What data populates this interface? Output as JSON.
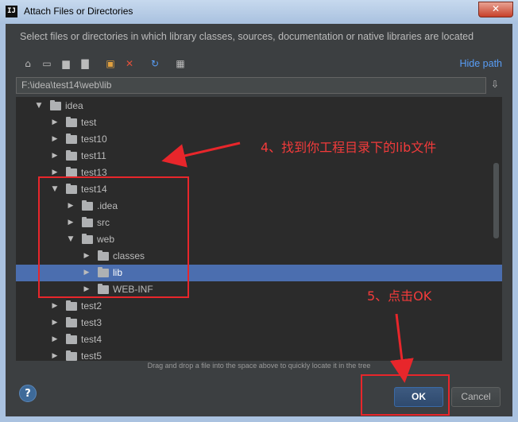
{
  "window": {
    "title": "Attach Files or Directories",
    "app_icon": "IJ",
    "close_icon": "✕"
  },
  "description": "Select files or directories in which library classes, sources, documentation or native libraries are located",
  "toolbar": {
    "icons": [
      "home-icon",
      "desktop-icon",
      "project-icon",
      "module-icon",
      "new-folder-icon",
      "delete-icon",
      "refresh-icon",
      "show-hidden-icon"
    ],
    "hide_path_label": "Hide path"
  },
  "path": {
    "value": "F:\\idea\\test14\\web\\lib"
  },
  "tree": {
    "rows": [
      {
        "label": "idea",
        "expanded": true,
        "depth": 0,
        "selected": false
      },
      {
        "label": "test",
        "expanded": false,
        "depth": 1,
        "selected": false
      },
      {
        "label": "test10",
        "expanded": false,
        "depth": 1,
        "selected": false
      },
      {
        "label": "test11",
        "expanded": false,
        "depth": 1,
        "selected": false
      },
      {
        "label": "test13",
        "expanded": false,
        "depth": 1,
        "selected": false
      },
      {
        "label": "test14",
        "expanded": true,
        "depth": 1,
        "selected": false
      },
      {
        "label": ".idea",
        "expanded": false,
        "depth": 2,
        "selected": false
      },
      {
        "label": "src",
        "expanded": false,
        "depth": 2,
        "selected": false
      },
      {
        "label": "web",
        "expanded": true,
        "depth": 2,
        "selected": false
      },
      {
        "label": "classes",
        "expanded": false,
        "depth": 3,
        "selected": false
      },
      {
        "label": "lib",
        "expanded": false,
        "depth": 3,
        "selected": true
      },
      {
        "label": "WEB-INF",
        "expanded": false,
        "depth": 3,
        "selected": false
      },
      {
        "label": "test2",
        "expanded": false,
        "depth": 1,
        "selected": false
      },
      {
        "label": "test3",
        "expanded": false,
        "depth": 1,
        "selected": false
      },
      {
        "label": "test4",
        "expanded": false,
        "depth": 1,
        "selected": false
      },
      {
        "label": "test5",
        "expanded": false,
        "depth": 1,
        "selected": false
      }
    ]
  },
  "hint": "Drag and drop a file into the space above to quickly locate it in the tree",
  "buttons": {
    "help": "?",
    "ok": "OK",
    "cancel": "Cancel"
  },
  "annotations": {
    "step4": "4、找到你工程目录下的lib文件",
    "step5": "5、点击OK",
    "color": "#e8262b"
  },
  "colors": {
    "selection": "#4b6eaf",
    "link": "#589df6",
    "background": "#3c3f41",
    "tree_background": "#2b2b2b"
  }
}
